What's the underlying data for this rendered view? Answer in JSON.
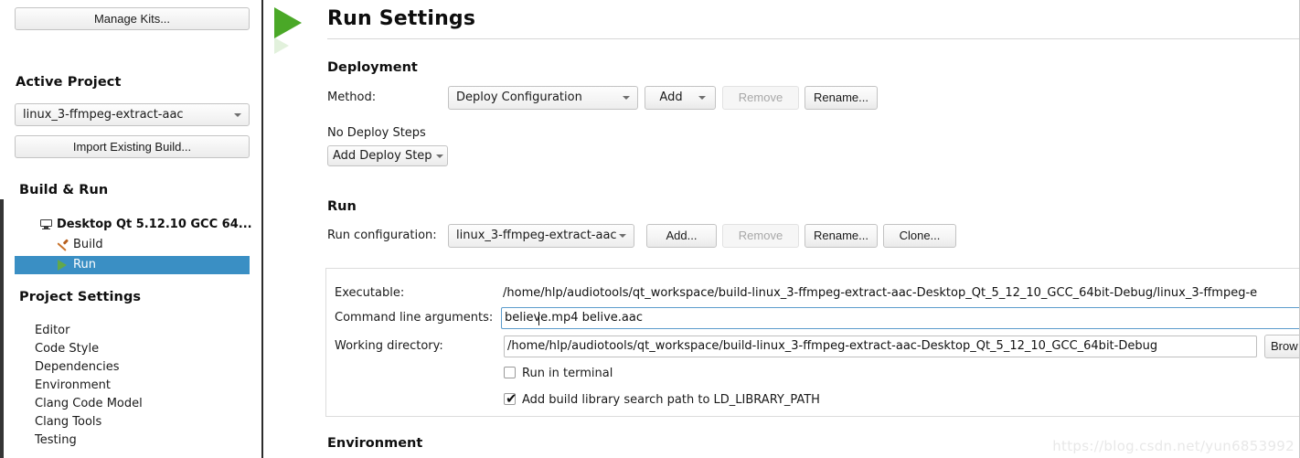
{
  "sidebar": {
    "manage_kits_label": "Manage Kits...",
    "active_project_heading": "Active Project",
    "active_project_value": "linux_3-ffmpeg-extract-aac",
    "import_existing_build_label": "Import Existing Build...",
    "build_and_run_heading": "Build & Run",
    "kit_name": "Desktop Qt 5.12.10 GCC 64...",
    "kit_children": [
      {
        "label": "Build",
        "icon": "hammer-icon",
        "selected": false
      },
      {
        "label": "Run",
        "icon": "play-icon",
        "selected": true
      }
    ],
    "project_settings_heading": "Project Settings",
    "project_settings_items": [
      "Editor",
      "Code Style",
      "Dependencies",
      "Environment",
      "Clang Code Model",
      "Clang Tools",
      "Testing"
    ]
  },
  "page": {
    "title": "Run Settings",
    "icon": "play-icon"
  },
  "deployment": {
    "heading": "Deployment",
    "method_label": "Method:",
    "method_value": "Deploy Configuration",
    "add_label": "Add",
    "remove_label": "Remove",
    "rename_label": "Rename...",
    "no_deploy_steps_label": "No Deploy Steps",
    "add_deploy_step_label": "Add Deploy Step"
  },
  "run": {
    "heading": "Run",
    "run_configuration_label": "Run configuration:",
    "run_configuration_value": "linux_3-ffmpeg-extract-aac",
    "add_label": "Add...",
    "remove_label": "Remove",
    "rename_label": "Rename...",
    "clone_label": "Clone...",
    "executable_label": "Executable:",
    "executable_value": "/home/hlp/audiotools/qt_workspace/build-linux_3-ffmpeg-extract-aac-Desktop_Qt_5_12_10_GCC_64bit-Debug/linux_3-ffmpeg-e",
    "command_line_arguments_label": "Command line arguments:",
    "command_line_arguments_value": "believe.mp4 belive.aac",
    "working_directory_label": "Working directory:",
    "working_directory_value": "/home/hlp/audiotools/qt_workspace/build-linux_3-ffmpeg-extract-aac-Desktop_Qt_5_12_10_GCC_64bit-Debug",
    "browse_label": "Brow",
    "run_in_terminal_label": "Run in terminal",
    "run_in_terminal_checked": false,
    "ld_library_path_label": "Add build library search path to LD_LIBRARY_PATH",
    "ld_library_path_checked": true,
    "ld_library_path_check_glyph": "✔"
  },
  "environment": {
    "heading": "Environment"
  },
  "watermark": {
    "text": "https://blog.csdn.net/yun6853992"
  },
  "colors": {
    "selection_blue": "#3a8fc4",
    "run_green": "#4aa827",
    "hammer_orange": "#c9722a",
    "focus_border": "#5c9ccc"
  }
}
